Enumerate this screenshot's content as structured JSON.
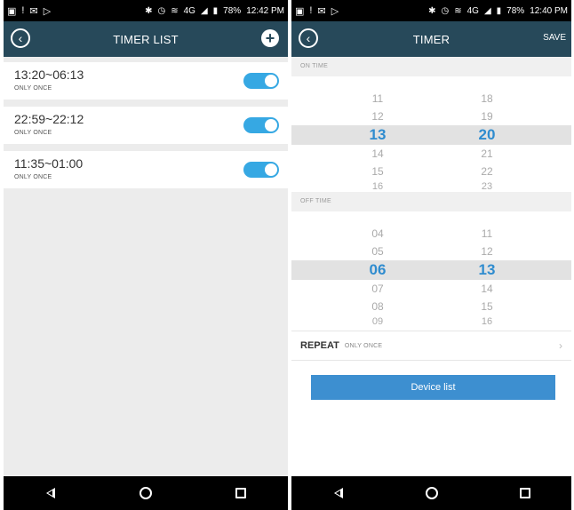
{
  "left": {
    "status": {
      "time": "12:42 PM",
      "battery": "78%",
      "network": "4G"
    },
    "header": {
      "title": "TIMER LIST"
    },
    "timers": [
      {
        "range": "13:20~06:13",
        "repeat": "ONLY ONCE",
        "enabled": true
      },
      {
        "range": "22:59~22:12",
        "repeat": "ONLY ONCE",
        "enabled": true
      },
      {
        "range": "11:35~01:00",
        "repeat": "ONLY ONCE",
        "enabled": true
      }
    ]
  },
  "right": {
    "status": {
      "time": "12:40 PM",
      "battery": "78%",
      "network": "4G"
    },
    "header": {
      "title": "TIMER",
      "save_label": "SAVE"
    },
    "on_time": {
      "label": "ON TIME",
      "hours": [
        "11",
        "12",
        "13",
        "14",
        "15",
        "16"
      ],
      "minutes": [
        "18",
        "19",
        "20",
        "21",
        "22",
        "23"
      ],
      "selected_hour": "13",
      "selected_minute": "20"
    },
    "off_time": {
      "label": "OFF TIME",
      "hours": [
        "04",
        "05",
        "06",
        "07",
        "08",
        "09"
      ],
      "minutes": [
        "11",
        "12",
        "13",
        "14",
        "15",
        "16"
      ],
      "selected_hour": "06",
      "selected_minute": "13"
    },
    "repeat": {
      "label": "REPEAT",
      "value": "ONLY ONCE"
    },
    "device_button": "Device list"
  },
  "colors": {
    "appbar": "#27495a",
    "accent": "#36a8e3",
    "button": "#3d8fd0"
  },
  "icons": [
    "back-circle-icon",
    "add-icon",
    "nav-back-icon",
    "nav-home-icon",
    "nav-recent-icon",
    "chevron-right-icon"
  ]
}
